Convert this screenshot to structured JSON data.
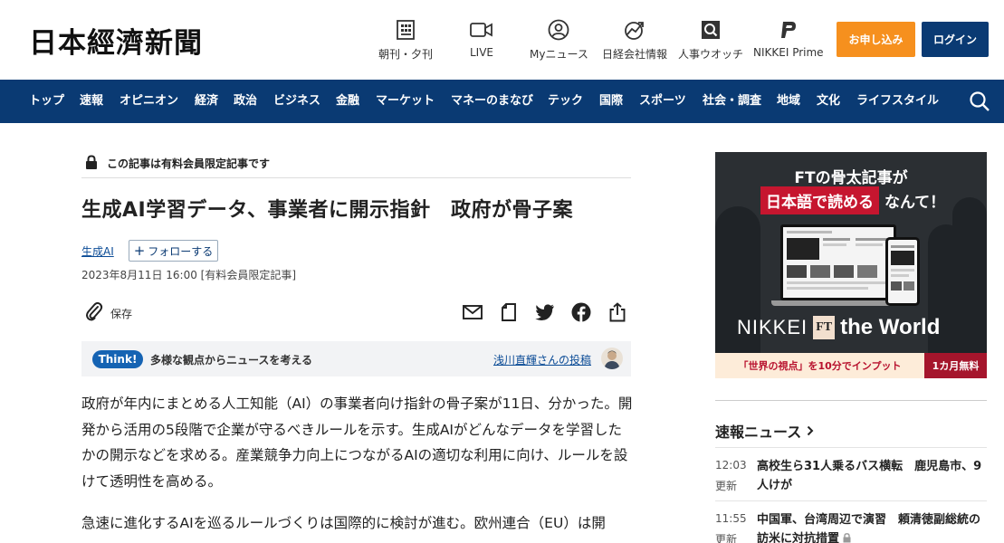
{
  "header": {
    "logo": "日本經濟新聞",
    "nav": [
      {
        "label": "朝刊・夕刊",
        "icon": "newspaper-icon"
      },
      {
        "label": "LIVE",
        "icon": "video-camera-icon"
      },
      {
        "label": "Myニュース",
        "icon": "user-icon"
      },
      {
        "label": "日経会社情報",
        "icon": "chart-icon"
      },
      {
        "label": "人事ウオッチ",
        "icon": "magnifier-icon"
      },
      {
        "label": "NIKKEI Prime",
        "icon": "prime-icon"
      }
    ],
    "apply_label": "お申し込み",
    "login_label": "ログイン",
    "accent_orange": "#f6901e",
    "brand_navy": "#0a3a73"
  },
  "navbar": {
    "items": [
      "トップ",
      "速報",
      "オピニオン",
      "経済",
      "政治",
      "ビジネス",
      "金融",
      "マーケット",
      "マネーのまなび",
      "テック",
      "国際",
      "スポーツ",
      "社会・調査",
      "地域",
      "文化",
      "ライフスタイル"
    ],
    "search_icon": "search-icon"
  },
  "article": {
    "lock_text": "この記事は有料会員限定記事です",
    "title": "生成AI学習データ、事業者に開示指針　政府が骨子案",
    "topic": "生成AI",
    "follow_label": "フォローする",
    "date": "2023年8月11日 16:00 [有料会員限定記事]",
    "save_label": "保存",
    "share_icons": [
      "mail-icon",
      "bookmark-icon",
      "twitter-icon",
      "facebook-icon",
      "share-icon"
    ],
    "think": {
      "badge": "Think!",
      "desc": "多様な観点からニュースを考える",
      "author": "浅川直輝さんの投稿"
    },
    "paragraphs": [
      "政府が年内にまとめる人工知能（AI）の事業者向け指針の骨子案が11日、分かった。開発から活用の5段階で企業が守るべきルールを示す。生成AIがどんなデータを学習したかの開示などを求める。産業競争力向上につながるAIの適切な利用に向け、ルールを設けて透明性を高める。",
      "急速に進化するAIを巡るルールづくりは国際的に検討が進む。欧州連合（EU）は開"
    ]
  },
  "ad": {
    "line1": "FTの骨太記事が",
    "line2_highlight": "日本語で読める",
    "line2_rest": "なんて！",
    "brand_left": "NIKKEI",
    "brand_ft": "FT",
    "brand_right": "the World",
    "bottom_left": "「世界の視点」を10分でインプット",
    "bottom_right": "1カ月無料"
  },
  "sidebar": {
    "flash_title": "速報ニュース",
    "news": [
      {
        "time": "12:03",
        "status": "更新",
        "headline": "高校生ら31人乗るバス横転　鹿児島市、9人けが"
      },
      {
        "time": "11:55",
        "status": "更新",
        "headline": "中国軍、台湾周辺で演習　頼清徳副総統の訪米に対抗措置"
      }
    ]
  }
}
